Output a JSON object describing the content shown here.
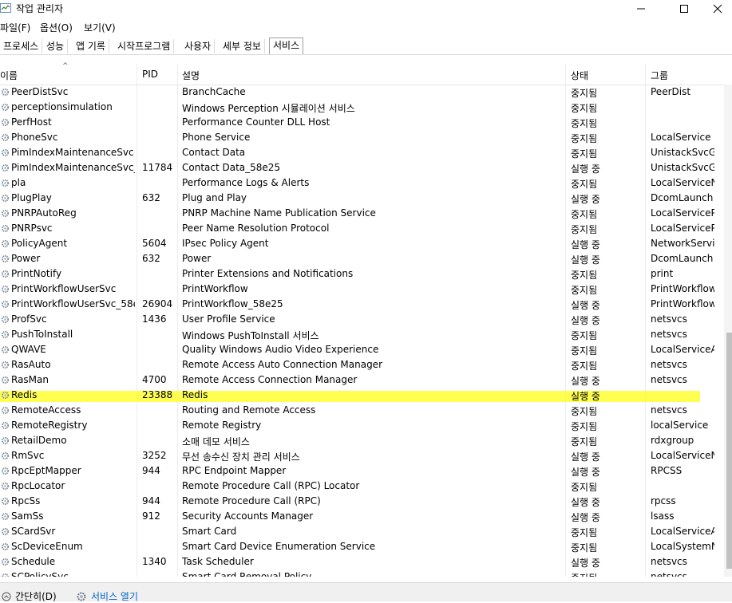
{
  "window": {
    "title": "작업 관리자",
    "controls": [
      "—",
      "☐",
      "✕"
    ]
  },
  "menu": [
    {
      "label": "파일(F)"
    },
    {
      "label": "옵션(O)"
    },
    {
      "label": "보기(V)"
    }
  ],
  "tabs": [
    {
      "label": "프로세스"
    },
    {
      "label": "성능"
    },
    {
      "label": "앱 기록"
    },
    {
      "label": "시작프로그램"
    },
    {
      "label": "사용자"
    },
    {
      "label": "세부 정보"
    },
    {
      "label": "서비스",
      "active": true
    }
  ],
  "columns": {
    "name": "이름",
    "pid": "PID",
    "desc": "설명",
    "status": "상태",
    "group": "그룹"
  },
  "rows": [
    {
      "name": "PeerDistSvc",
      "pid": "",
      "desc": "BranchCache",
      "status": "중지됨",
      "group": "PeerDist"
    },
    {
      "name": "perceptionsimulation",
      "pid": "",
      "desc": "Windows Perception 시뮬레이션 서비스",
      "status": "중지됨",
      "group": ""
    },
    {
      "name": "PerfHost",
      "pid": "",
      "desc": "Performance Counter DLL Host",
      "status": "중지됨",
      "group": ""
    },
    {
      "name": "PhoneSvc",
      "pid": "",
      "desc": "Phone Service",
      "status": "중지됨",
      "group": "LocalService"
    },
    {
      "name": "PimIndexMaintenanceSvc",
      "pid": "",
      "desc": "Contact Data",
      "status": "중지됨",
      "group": "UnistackSvcGr..."
    },
    {
      "name": "PimIndexMaintenanceSvc_...",
      "pid": "11784",
      "desc": "Contact Data_58e25",
      "status": "실행 중",
      "group": "UnistackSvcGr..."
    },
    {
      "name": "pla",
      "pid": "",
      "desc": "Performance Logs & Alerts",
      "status": "중지됨",
      "group": "LocalServiceN..."
    },
    {
      "name": "PlugPlay",
      "pid": "632",
      "desc": "Plug and Play",
      "status": "실행 중",
      "group": "DcomLaunch"
    },
    {
      "name": "PNRPAutoReg",
      "pid": "",
      "desc": "PNRP Machine Name Publication Service",
      "status": "중지됨",
      "group": "LocalServiceP..."
    },
    {
      "name": "PNRPsvc",
      "pid": "",
      "desc": "Peer Name Resolution Protocol",
      "status": "중지됨",
      "group": "LocalServiceP..."
    },
    {
      "name": "PolicyAgent",
      "pid": "5604",
      "desc": "IPsec Policy Agent",
      "status": "실행 중",
      "group": "NetworkServic..."
    },
    {
      "name": "Power",
      "pid": "632",
      "desc": "Power",
      "status": "실행 중",
      "group": "DcomLaunch"
    },
    {
      "name": "PrintNotify",
      "pid": "",
      "desc": "Printer Extensions and Notifications",
      "status": "중지됨",
      "group": "print"
    },
    {
      "name": "PrintWorkflowUserSvc",
      "pid": "",
      "desc": "PrintWorkflow",
      "status": "중지됨",
      "group": "PrintWorkflow"
    },
    {
      "name": "PrintWorkflowUserSvc_58e...",
      "pid": "26904",
      "desc": "PrintWorkflow_58e25",
      "status": "실행 중",
      "group": "PrintWorkflow"
    },
    {
      "name": "ProfSvc",
      "pid": "1436",
      "desc": "User Profile Service",
      "status": "실행 중",
      "group": "netsvcs"
    },
    {
      "name": "PushToInstall",
      "pid": "",
      "desc": "Windows PushToInstall 서비스",
      "status": "중지됨",
      "group": "netsvcs"
    },
    {
      "name": "QWAVE",
      "pid": "",
      "desc": "Quality Windows Audio Video Experience",
      "status": "중지됨",
      "group": "LocalServiceA..."
    },
    {
      "name": "RasAuto",
      "pid": "",
      "desc": "Remote Access Auto Connection Manager",
      "status": "중지됨",
      "group": "netsvcs"
    },
    {
      "name": "RasMan",
      "pid": "4700",
      "desc": "Remote Access Connection Manager",
      "status": "실행 중",
      "group": "netsvcs"
    },
    {
      "name": "Redis",
      "pid": "23388",
      "desc": "Redis",
      "status": "실행 중",
      "group": "",
      "highlighted": true
    },
    {
      "name": "RemoteAccess",
      "pid": "",
      "desc": "Routing and Remote Access",
      "status": "중지됨",
      "group": "netsvcs"
    },
    {
      "name": "RemoteRegistry",
      "pid": "",
      "desc": "Remote Registry",
      "status": "중지됨",
      "group": "localService"
    },
    {
      "name": "RetailDemo",
      "pid": "",
      "desc": "소매 데모 서비스",
      "status": "중지됨",
      "group": "rdxgroup"
    },
    {
      "name": "RmSvc",
      "pid": "3252",
      "desc": "무선 송수신 장치 관리 서비스",
      "status": "실행 중",
      "group": "LocalServiceN..."
    },
    {
      "name": "RpcEptMapper",
      "pid": "944",
      "desc": "RPC Endpoint Mapper",
      "status": "실행 중",
      "group": "RPCSS"
    },
    {
      "name": "RpcLocator",
      "pid": "",
      "desc": "Remote Procedure Call (RPC) Locator",
      "status": "중지됨",
      "group": ""
    },
    {
      "name": "RpcSs",
      "pid": "944",
      "desc": "Remote Procedure Call (RPC)",
      "status": "실행 중",
      "group": "rpcss"
    },
    {
      "name": "SamSs",
      "pid": "912",
      "desc": "Security Accounts Manager",
      "status": "실행 중",
      "group": "lsass"
    },
    {
      "name": "SCardSvr",
      "pid": "",
      "desc": "Smart Card",
      "status": "중지됨",
      "group": "LocalServiceA..."
    },
    {
      "name": "ScDeviceEnum",
      "pid": "",
      "desc": "Smart Card Device Enumeration Service",
      "status": "중지됨",
      "group": "LocalSystemN..."
    },
    {
      "name": "Schedule",
      "pid": "1340",
      "desc": "Task Scheduler",
      "status": "실행 중",
      "group": "netsvcs"
    },
    {
      "name": "SCPolicySvc",
      "pid": "",
      "desc": "Smart Card Removal Policy",
      "status": "중지됨",
      "group": "netsvcs"
    }
  ],
  "footer": {
    "fewer_details": "간단히(D)",
    "open_services": "서비스 열기"
  },
  "colors": {
    "highlight": "#ffff33",
    "link": "#0066cc"
  }
}
